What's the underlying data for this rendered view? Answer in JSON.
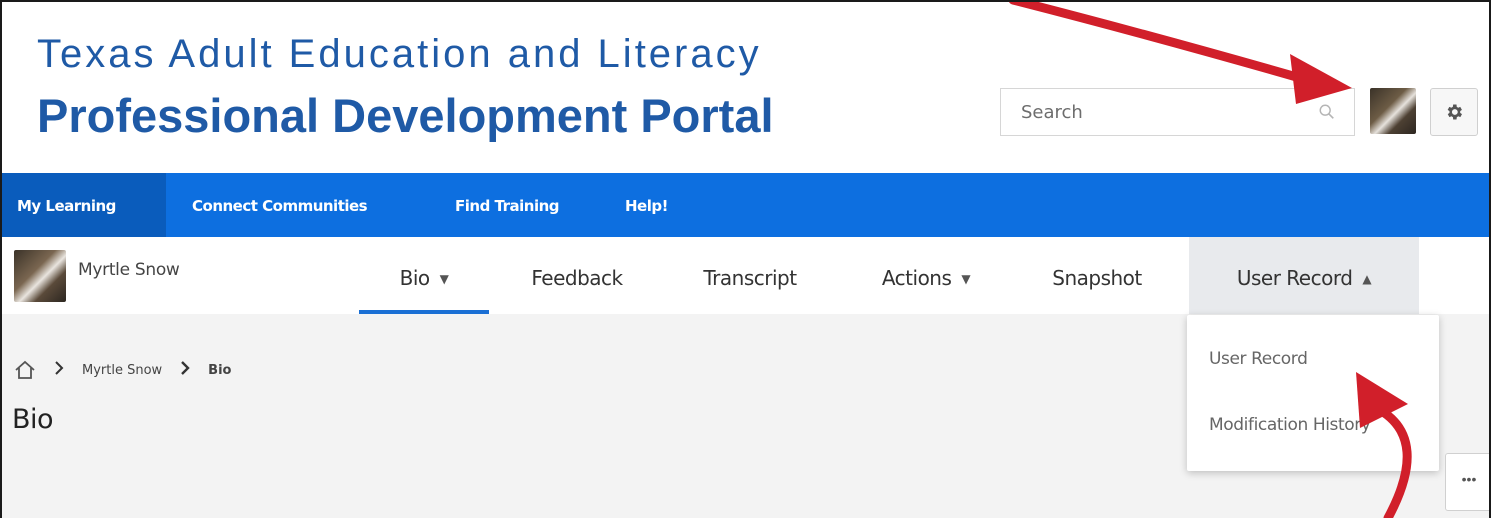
{
  "header": {
    "title_line1": "Texas Adult Education and Literacy",
    "title_line2": "Professional Development Portal",
    "search_placeholder": "Search"
  },
  "nav": {
    "items": [
      {
        "label": "My Learning",
        "active": true
      },
      {
        "label": "Connect Communities",
        "active": false
      },
      {
        "label": "Find Training",
        "active": false
      },
      {
        "label": "Help!",
        "active": false
      }
    ]
  },
  "profile": {
    "user_name": "Myrtle Snow"
  },
  "tabs": [
    {
      "label": "Bio",
      "has_caret": true,
      "active": true
    },
    {
      "label": "Feedback",
      "has_caret": false,
      "active": false
    },
    {
      "label": "Transcript",
      "has_caret": false,
      "active": false
    },
    {
      "label": "Actions",
      "has_caret": true,
      "active": false
    },
    {
      "label": "Snapshot",
      "has_caret": false,
      "active": false
    },
    {
      "label": "User Record",
      "has_caret": true,
      "active": false,
      "open": true
    }
  ],
  "breadcrumb": {
    "items": [
      "Myrtle Snow",
      "Bio"
    ]
  },
  "page": {
    "title": "Bio"
  },
  "dropdown": {
    "items": [
      "User Record",
      "Modification History"
    ]
  },
  "colors": {
    "brand_blue": "#1f5aa6",
    "nav_blue": "#0d6fe0",
    "nav_active": "#0a5cbc",
    "tab_underline": "#1a6fd4",
    "arrow_red": "#d11f2a"
  }
}
